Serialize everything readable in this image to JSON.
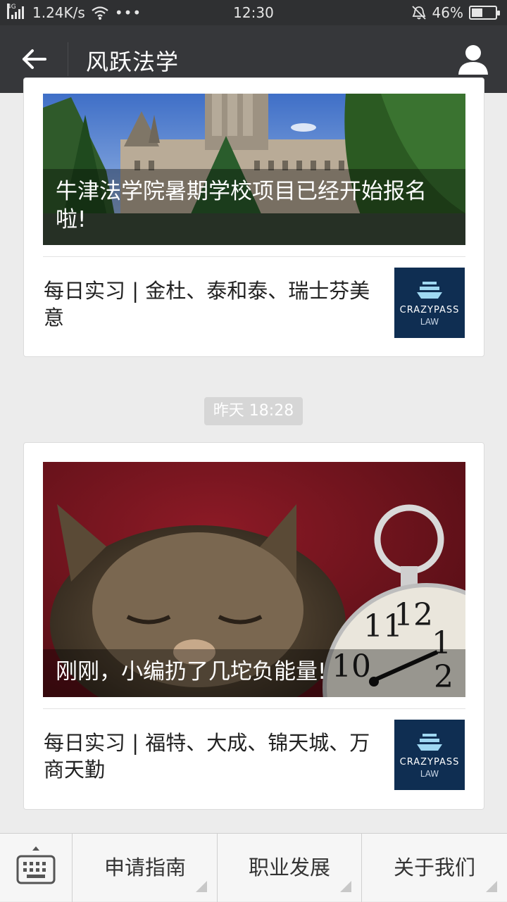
{
  "status_bar": {
    "network_type": "4G",
    "speed": "1.24K/s",
    "more": "•••",
    "time": "12:30",
    "battery": "46%",
    "battery_level": 0.46
  },
  "header": {
    "title": "风跃法学"
  },
  "card1": {
    "cover_caption": "牛津法学院暑期学校项目已经开始报名啦!",
    "item_title": "每日实习 | 金杜、泰和泰、瑞士芬美意",
    "thumb_brand": "CRAZYPASS",
    "thumb_sub": "LAW"
  },
  "timestamp": "昨天 18:28",
  "card2": {
    "cover_caption": "刚刚，小编扔了几坨负能量!",
    "item_title": "每日实习 | 福特、大成、锦天城、万商天勤",
    "thumb_brand": "CRAZYPASS",
    "thumb_sub": "LAW"
  },
  "bottom_menu": {
    "items": [
      "申请指南",
      "职业发展",
      "关于我们"
    ]
  }
}
